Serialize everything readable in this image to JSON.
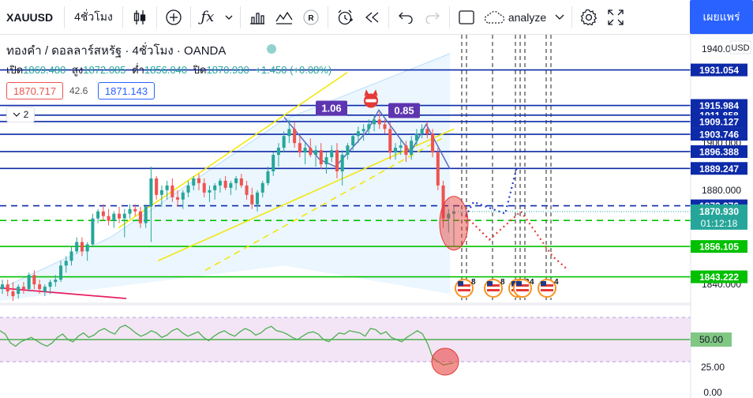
{
  "toolbar": {
    "symbol": "XAUUSD",
    "interval": "4ชั่วโมง",
    "analyze_label": "analyze",
    "publish_label": "เผยแพร่",
    "icons": [
      "candles-icon",
      "add-indicator-icon",
      "fx-icon",
      "chevron-down-icon",
      "bars-icon",
      "indicators-icon",
      "replay-r-icon",
      "alarm-icon",
      "rewind-icon",
      "undo-icon",
      "redo-icon",
      "square-icon",
      "cloud-icon",
      "chevron-down-icon",
      "gear-icon",
      "fullscreen-icon"
    ]
  },
  "legend": {
    "title": "ทองคำ / ดอลลาร์สหรัฐ · 4ชั่วโมง · OANDA",
    "open_label": "เปิด",
    "open": "1869.480",
    "high_label": "สูง",
    "high": "1872.085",
    "low_label": "ต่ำ",
    "low": "1856.040",
    "close_label": "ปิด",
    "close": "1870.930",
    "change": "+1.450 (+0.08%)",
    "bid": "1870.717",
    "spread": "42.6",
    "ask": "1871.143",
    "collapse_count": "2"
  },
  "colors": {
    "up": "#26a69a",
    "down": "#ef5350",
    "level": "#0d2aa8",
    "green_line": "#00c000",
    "channel": "#f2e600",
    "label_bg": "#1a237e",
    "rsi": "#4caf50",
    "rsi_bg": "#f3e5f5"
  },
  "chart_data": {
    "type": "candlestick",
    "symbol": "XAUUSD",
    "timeframe": "4ชั่วโมง",
    "price_axis": {
      "ticks": [
        "1940.000",
        "1900.000",
        "1880.000",
        "1840.000"
      ],
      "range": [
        1832,
        1946
      ],
      "currency": "USD"
    },
    "candles": [
      [
        1838,
        1842,
        1836,
        1840
      ],
      [
        1840,
        1842,
        1835,
        1837
      ],
      [
        1837,
        1841,
        1833,
        1835
      ],
      [
        1836,
        1840,
        1834,
        1839
      ],
      [
        1839,
        1841,
        1836,
        1838
      ],
      [
        1838,
        1845,
        1837,
        1844
      ],
      [
        1844,
        1846,
        1838,
        1840
      ],
      [
        1840,
        1842,
        1836,
        1838
      ],
      [
        1837,
        1840,
        1835,
        1839
      ],
      [
        1839,
        1842,
        1836,
        1841
      ],
      [
        1841,
        1844,
        1839,
        1842
      ],
      [
        1842,
        1850,
        1841,
        1848
      ],
      [
        1848,
        1852,
        1845,
        1850
      ],
      [
        1850,
        1856,
        1848,
        1854
      ],
      [
        1854,
        1860,
        1853,
        1858
      ],
      [
        1858,
        1860,
        1852,
        1854
      ],
      [
        1854,
        1858,
        1850,
        1857
      ],
      [
        1857,
        1870,
        1856,
        1868
      ],
      [
        1868,
        1872,
        1866,
        1871
      ],
      [
        1871,
        1874,
        1867,
        1869
      ],
      [
        1869,
        1872,
        1865,
        1867
      ],
      [
        1867,
        1871,
        1864,
        1870
      ],
      [
        1870,
        1873,
        1866,
        1868
      ],
      [
        1868,
        1872,
        1860,
        1870
      ],
      [
        1870,
        1874,
        1868,
        1872
      ],
      [
        1872,
        1874,
        1869,
        1871
      ],
      [
        1871,
        1873,
        1864,
        1866
      ],
      [
        1866,
        1874,
        1864,
        1873
      ],
      [
        1873,
        1890,
        1858,
        1885
      ],
      [
        1885,
        1886,
        1876,
        1878
      ],
      [
        1878,
        1882,
        1873,
        1880
      ],
      [
        1880,
        1884,
        1876,
        1882
      ],
      [
        1882,
        1885,
        1875,
        1877
      ],
      [
        1877,
        1880,
        1873,
        1876
      ],
      [
        1876,
        1880,
        1872,
        1879
      ],
      [
        1879,
        1884,
        1877,
        1882
      ],
      [
        1882,
        1886,
        1880,
        1885
      ],
      [
        1885,
        1887,
        1880,
        1883
      ],
      [
        1883,
        1885,
        1877,
        1879
      ],
      [
        1879,
        1882,
        1875,
        1880
      ],
      [
        1880,
        1883,
        1876,
        1882
      ],
      [
        1882,
        1885,
        1879,
        1884
      ],
      [
        1884,
        1886,
        1880,
        1881
      ],
      [
        1881,
        1884,
        1878,
        1883
      ],
      [
        1883,
        1886,
        1880,
        1885
      ],
      [
        1885,
        1887,
        1881,
        1882
      ],
      [
        1882,
        1884,
        1876,
        1878
      ],
      [
        1878,
        1881,
        1872,
        1874
      ],
      [
        1874,
        1880,
        1871,
        1879
      ],
      [
        1879,
        1884,
        1877,
        1883
      ],
      [
        1883,
        1890,
        1882,
        1888
      ],
      [
        1888,
        1896,
        1886,
        1895
      ],
      [
        1895,
        1900,
        1890,
        1898
      ],
      [
        1898,
        1905,
        1896,
        1903
      ],
      [
        1903,
        1910,
        1900,
        1906
      ],
      [
        1906,
        1909,
        1898,
        1900
      ],
      [
        1900,
        1903,
        1894,
        1896
      ],
      [
        1896,
        1900,
        1891,
        1898
      ],
      [
        1898,
        1902,
        1894,
        1895
      ],
      [
        1895,
        1899,
        1890,
        1897
      ],
      [
        1897,
        1900,
        1889,
        1891
      ],
      [
        1891,
        1896,
        1887,
        1894
      ],
      [
        1894,
        1899,
        1892,
        1897
      ],
      [
        1897,
        1900,
        1885,
        1888
      ],
      [
        1888,
        1897,
        1882,
        1895
      ],
      [
        1895,
        1900,
        1893,
        1899
      ],
      [
        1899,
        1904,
        1897,
        1903
      ],
      [
        1903,
        1907,
        1900,
        1905
      ],
      [
        1905,
        1908,
        1901,
        1906
      ],
      [
        1906,
        1910,
        1904,
        1908
      ],
      [
        1908,
        1912,
        1905,
        1910
      ],
      [
        1910,
        1913,
        1906,
        1908
      ],
      [
        1908,
        1910,
        1904,
        1906
      ],
      [
        1906,
        1909,
        1893,
        1896
      ],
      [
        1896,
        1900,
        1893,
        1898
      ],
      [
        1898,
        1902,
        1895,
        1899
      ],
      [
        1899,
        1901,
        1892,
        1895
      ],
      [
        1895,
        1903,
        1893,
        1901
      ],
      [
        1901,
        1906,
        1899,
        1904
      ],
      [
        1904,
        1908,
        1902,
        1906
      ],
      [
        1906,
        1909,
        1902,
        1904
      ],
      [
        1904,
        1906,
        1894,
        1896
      ],
      [
        1896,
        1898,
        1880,
        1882
      ],
      [
        1882,
        1884,
        1864,
        1868
      ],
      [
        1868,
        1872,
        1862,
        1870
      ],
      [
        1870,
        1873,
        1856,
        1871
      ]
    ],
    "horizontal_levels": [
      {
        "price": "1931.054",
        "style": "solid",
        "color": "#0d2aa8"
      },
      {
        "price": "1915.984",
        "style": "solid",
        "color": "#0d2aa8"
      },
      {
        "price": "1911.858",
        "style": "solid",
        "color": "#0d2aa8"
      },
      {
        "price": "1909.127",
        "style": "solid",
        "color": "#0d2aa8"
      },
      {
        "price": "1903.746",
        "style": "solid",
        "color": "#0d2aa8"
      },
      {
        "price": "1896.388",
        "style": "solid",
        "color": "#0d2aa8"
      },
      {
        "price": "1889.247",
        "style": "solid",
        "color": "#0d2aa8"
      },
      {
        "price": "1873.376",
        "style": "dashed",
        "color": "#0d2aa8"
      },
      {
        "price": "1867.145",
        "style": "dashed",
        "color": "#00c000"
      },
      {
        "price": "1856.105",
        "style": "solid",
        "color": "#00c000"
      },
      {
        "price": "1843.222",
        "style": "solid",
        "color": "#00c000"
      }
    ],
    "current_price": {
      "price": "1870.930",
      "countdown": "01:12:18"
    },
    "annotations": [
      "1.06",
      "0.85"
    ],
    "event_badges": [
      "8",
      "8",
      "2",
      "4",
      "4"
    ],
    "rsi": {
      "ticks": [
        "50.00",
        "25.00",
        "0.00"
      ],
      "range": [
        0,
        80
      ],
      "values": [
        58,
        55,
        47,
        44,
        48,
        50,
        52,
        49,
        46,
        44,
        47,
        52,
        55,
        50,
        48,
        53,
        56,
        52,
        54,
        58,
        60,
        57,
        55,
        61,
        63,
        60,
        56,
        53,
        55,
        58,
        56,
        52,
        54,
        58,
        60,
        56,
        53,
        55,
        57,
        52,
        49,
        53,
        56,
        58,
        55,
        53,
        57,
        60,
        58,
        54,
        56,
        60,
        62,
        58,
        57,
        55,
        52,
        50,
        53,
        56,
        57,
        55,
        50,
        48,
        52,
        56,
        55,
        58,
        57,
        56,
        53,
        60,
        59,
        55,
        57,
        52,
        50,
        48,
        52,
        55,
        58,
        55,
        46,
        33,
        30,
        27,
        28,
        29
      ]
    }
  }
}
